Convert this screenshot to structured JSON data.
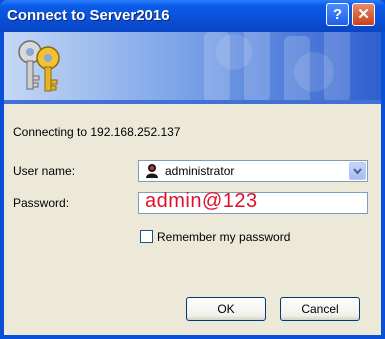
{
  "window": {
    "title": "Connect to Server2016"
  },
  "dialog": {
    "connecting_text": "Connecting to 192.168.252.137",
    "username_label": "User name:",
    "username_value": "administrator",
    "password_label": "Password:",
    "password_value": "admin@123",
    "remember_label": "Remember my password",
    "remember_checked": false,
    "ok_label": "OK",
    "cancel_label": "Cancel"
  },
  "title_buttons": {
    "help_glyph": "?",
    "close_glyph": "✕"
  },
  "colors": {
    "title_bar": "#0a4fd8",
    "dialog_bg": "#ece9d8",
    "password_text": "#e0102a"
  },
  "icons": [
    "keys-icon",
    "user-icon",
    "chevron-down-icon",
    "help-icon",
    "close-icon"
  ]
}
